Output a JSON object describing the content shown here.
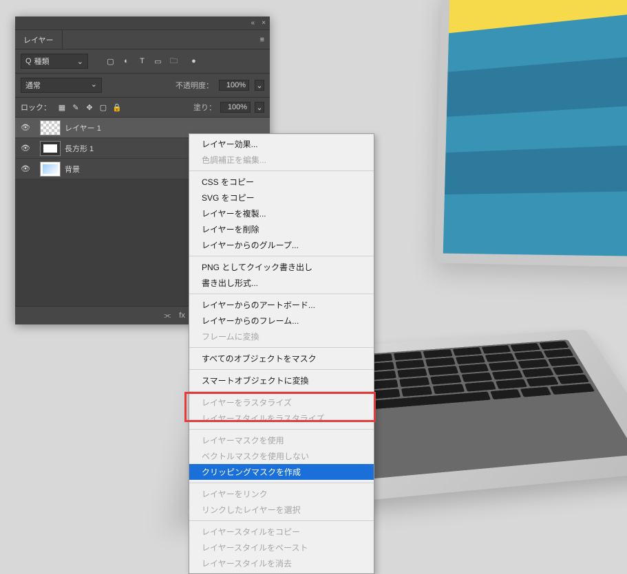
{
  "panel": {
    "title": "レイヤー",
    "kind_search": "種類",
    "blend_mode": "通常",
    "opacity_label": "不透明度：",
    "opacity_value": "100%",
    "lock_label": "ロック：",
    "fill_label": "塗り：",
    "fill_value": "100%",
    "layers": [
      {
        "name": "レイヤー 1"
      },
      {
        "name": "長方形 1"
      },
      {
        "name": "背景"
      }
    ]
  },
  "context_menu": {
    "groups": [
      [
        {
          "label": "レイヤー効果...",
          "enabled": true
        },
        {
          "label": "色調補正を編集...",
          "enabled": false
        }
      ],
      [
        {
          "label": "CSS をコピー",
          "enabled": true
        },
        {
          "label": "SVG をコピー",
          "enabled": true
        },
        {
          "label": "レイヤーを複製...",
          "enabled": true
        },
        {
          "label": "レイヤーを削除",
          "enabled": true
        },
        {
          "label": "レイヤーからのグループ...",
          "enabled": true
        }
      ],
      [
        {
          "label": "PNG としてクイック書き出し",
          "enabled": true
        },
        {
          "label": "書き出し形式...",
          "enabled": true
        }
      ],
      [
        {
          "label": "レイヤーからのアートボード...",
          "enabled": true
        },
        {
          "label": "レイヤーからのフレーム...",
          "enabled": true
        },
        {
          "label": "フレームに変換",
          "enabled": false
        }
      ],
      [
        {
          "label": "すべてのオブジェクトをマスク",
          "enabled": true
        }
      ],
      [
        {
          "label": "スマートオブジェクトに変換",
          "enabled": true
        }
      ],
      [
        {
          "label": "レイヤーをラスタライズ",
          "enabled": false
        },
        {
          "label": "レイヤースタイルをラスタライズ",
          "enabled": false
        }
      ],
      [
        {
          "label": "レイヤーマスクを使用",
          "enabled": false
        },
        {
          "label": "ベクトルマスクを使用しない",
          "enabled": false
        },
        {
          "label": "クリッピングマスクを作成",
          "enabled": true,
          "highlight": true
        }
      ],
      [
        {
          "label": "レイヤーをリンク",
          "enabled": false
        },
        {
          "label": "リンクしたレイヤーを選択",
          "enabled": false
        }
      ],
      [
        {
          "label": "レイヤースタイルをコピー",
          "enabled": false
        },
        {
          "label": "レイヤースタイルをペースト",
          "enabled": false
        },
        {
          "label": "レイヤースタイルを消去",
          "enabled": false
        }
      ]
    ]
  },
  "icons": {
    "collapse": "«",
    "close": "×",
    "menu": "≡",
    "search": "Q",
    "dd": "⌄",
    "eye": "👁",
    "image": "▢",
    "adjust": "◐",
    "text": "T",
    "shape": "▭",
    "smart": "🗀",
    "dot": "●",
    "lk_img": "▦",
    "lk_brush": "✎",
    "lk_move": "✥",
    "lk_frame": "▢",
    "lk_lock": "🔒",
    "link": "⫘",
    "fx": "fx",
    "mask": "◯",
    "adj": "◐",
    "folder": "🗀",
    "new": "⊞",
    "trash": "🗑"
  }
}
